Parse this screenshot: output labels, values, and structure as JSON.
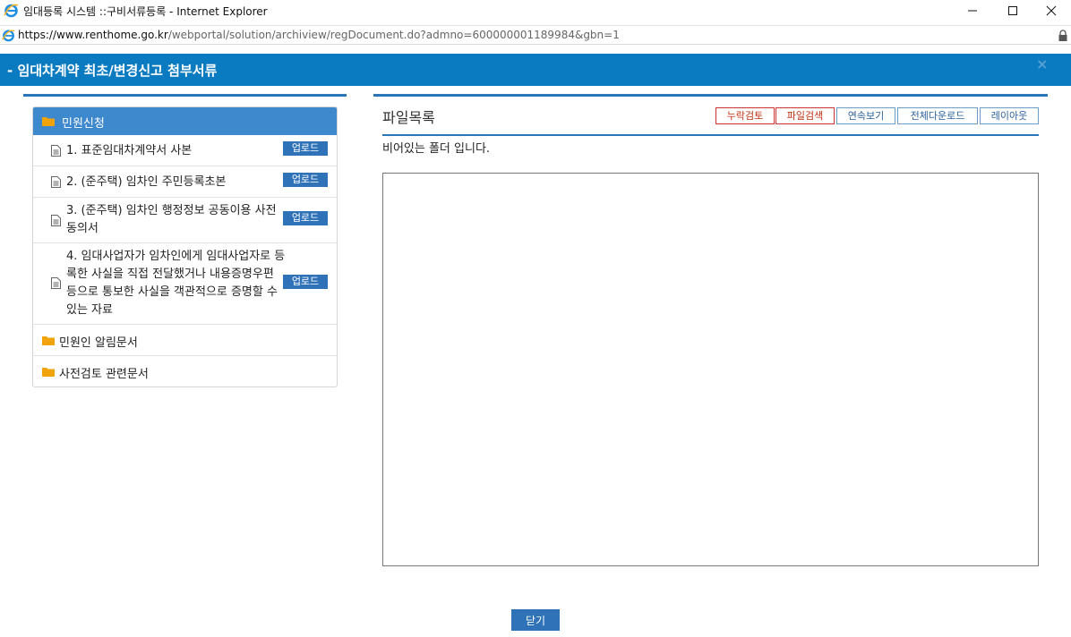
{
  "window": {
    "title": "임대등록 시스템 ::구비서류등록 - Internet Explorer",
    "url_host": "https://www.renthome.go.kr",
    "url_rest": "/webportal/solution/archiview/regDocument.do?admno=600000001189984&gbn=1"
  },
  "popup": {
    "title": "임대차계약 최초/변경신고 첨부서류",
    "close_glyph": "×"
  },
  "tree": {
    "root_label": "민원신청",
    "upload_label": "업로드",
    "documents": [
      {
        "label": "1. 표준임대차계약서 사본"
      },
      {
        "label": "2. (준주택) 임차인 주민등록초본"
      },
      {
        "label": "3. (준주택) 임차인 행정정보 공동이용 사전동의서"
      },
      {
        "label": "4. 임대사업자가 임차인에게 임대사업자로 등록한 사실을 직접 전달했거나 내용증명우편 등으로 통보한 사실을 객관적으로 증명할 수 있는 자료"
      }
    ],
    "folders": [
      {
        "label": "민원인 알림문서"
      },
      {
        "label": "사전검토 관련문서"
      }
    ]
  },
  "files": {
    "heading": "파일목록",
    "empty_message": "비어있는 폴더 입니다.",
    "toolbar": {
      "missing_check": "누락검토",
      "file_search": "파일검색",
      "continuous_view": "연속보기",
      "download_all": "전체다운로드",
      "layout": "레이아웃"
    }
  },
  "footer": {
    "close_label": "닫기"
  },
  "colors": {
    "header_bg": "#0a7bc1",
    "tree_root_bg": "#3e88cd",
    "accent_rule": "#2a75b8",
    "upload_btn": "#2f72b8",
    "folder_icon": "#f0a30a"
  }
}
